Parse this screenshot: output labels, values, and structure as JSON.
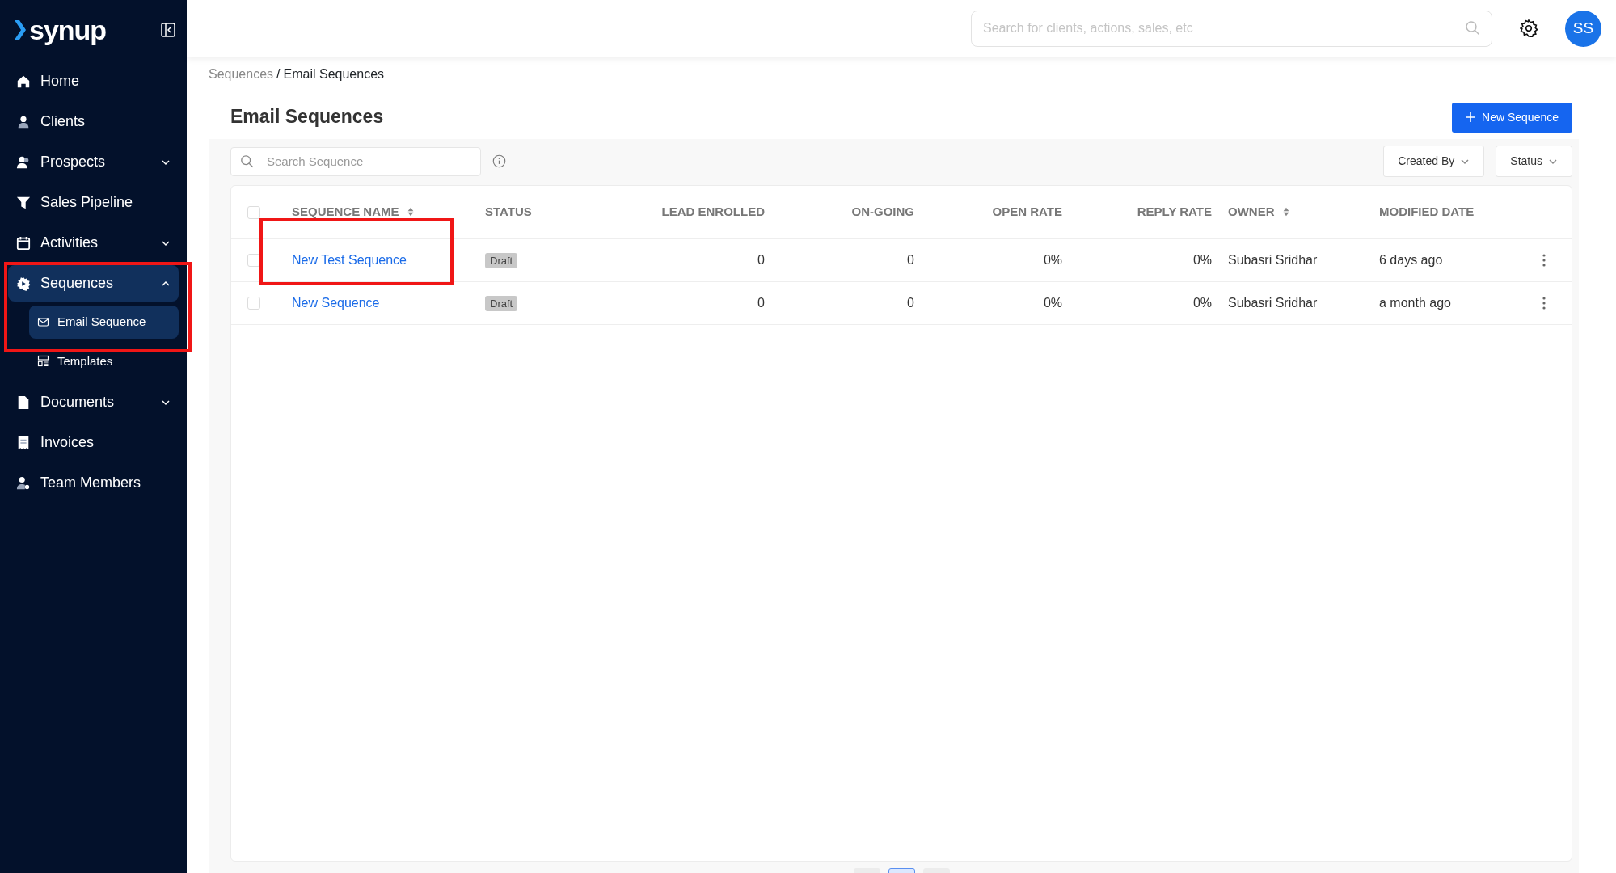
{
  "sidebar": {
    "logo": "synup",
    "items": [
      {
        "label": "Home"
      },
      {
        "label": "Clients"
      },
      {
        "label": "Prospects",
        "expanded": false
      },
      {
        "label": "Sales Pipeline"
      },
      {
        "label": "Activities",
        "expanded": false
      },
      {
        "label": "Sequences",
        "expanded": true,
        "highlighted": true,
        "children": [
          {
            "label": "Email Sequence",
            "selected": true
          },
          {
            "label": "Templates",
            "selected": false
          }
        ]
      },
      {
        "label": "Documents",
        "expanded": false
      },
      {
        "label": "Invoices"
      },
      {
        "label": "Team Members"
      }
    ]
  },
  "topbar": {
    "search": {
      "placeholder": "Search for clients, actions, sales, etc"
    },
    "avatar": "SS"
  },
  "breadcrumb": {
    "items": [
      "Sequences",
      "Email Sequences"
    ],
    "separator": "/"
  },
  "page_title": "Email Sequences",
  "new_button": "New Sequence",
  "search": {
    "placeholder": "Search Sequence"
  },
  "filters": [
    "Created By",
    "Status"
  ],
  "table": {
    "select_all": {
      "checked": false
    },
    "columns": [
      {
        "label": "SEQUENCE NAME",
        "sortable": true
      },
      {
        "label": "STATUS",
        "sortable": false
      },
      {
        "label": "LEAD ENROLLED",
        "sortable": false
      },
      {
        "label": "ON-GOING",
        "sortable": false
      },
      {
        "label": "OPEN RATE",
        "sortable": false
      },
      {
        "label": "REPLY RATE",
        "sortable": false
      },
      {
        "label": "OWNER",
        "sortable": true
      },
      {
        "label": "MODIFIED DATE",
        "sortable": false
      }
    ],
    "rows": [
      {
        "checked": false,
        "highlighted": true,
        "cells": [
          "New Test Sequence",
          "Draft",
          "0",
          "0",
          "0%",
          "0%",
          "Subasri Sridhar",
          "6 days ago"
        ]
      },
      {
        "checked": false,
        "cells": [
          "New Sequence",
          "Draft",
          "0",
          "0",
          "0%",
          "0%",
          "Subasri Sridhar",
          "a month ago"
        ]
      }
    ]
  },
  "pagination": [
    {
      "selected": false
    },
    {
      "selected": true
    },
    {
      "selected": false
    }
  ]
}
